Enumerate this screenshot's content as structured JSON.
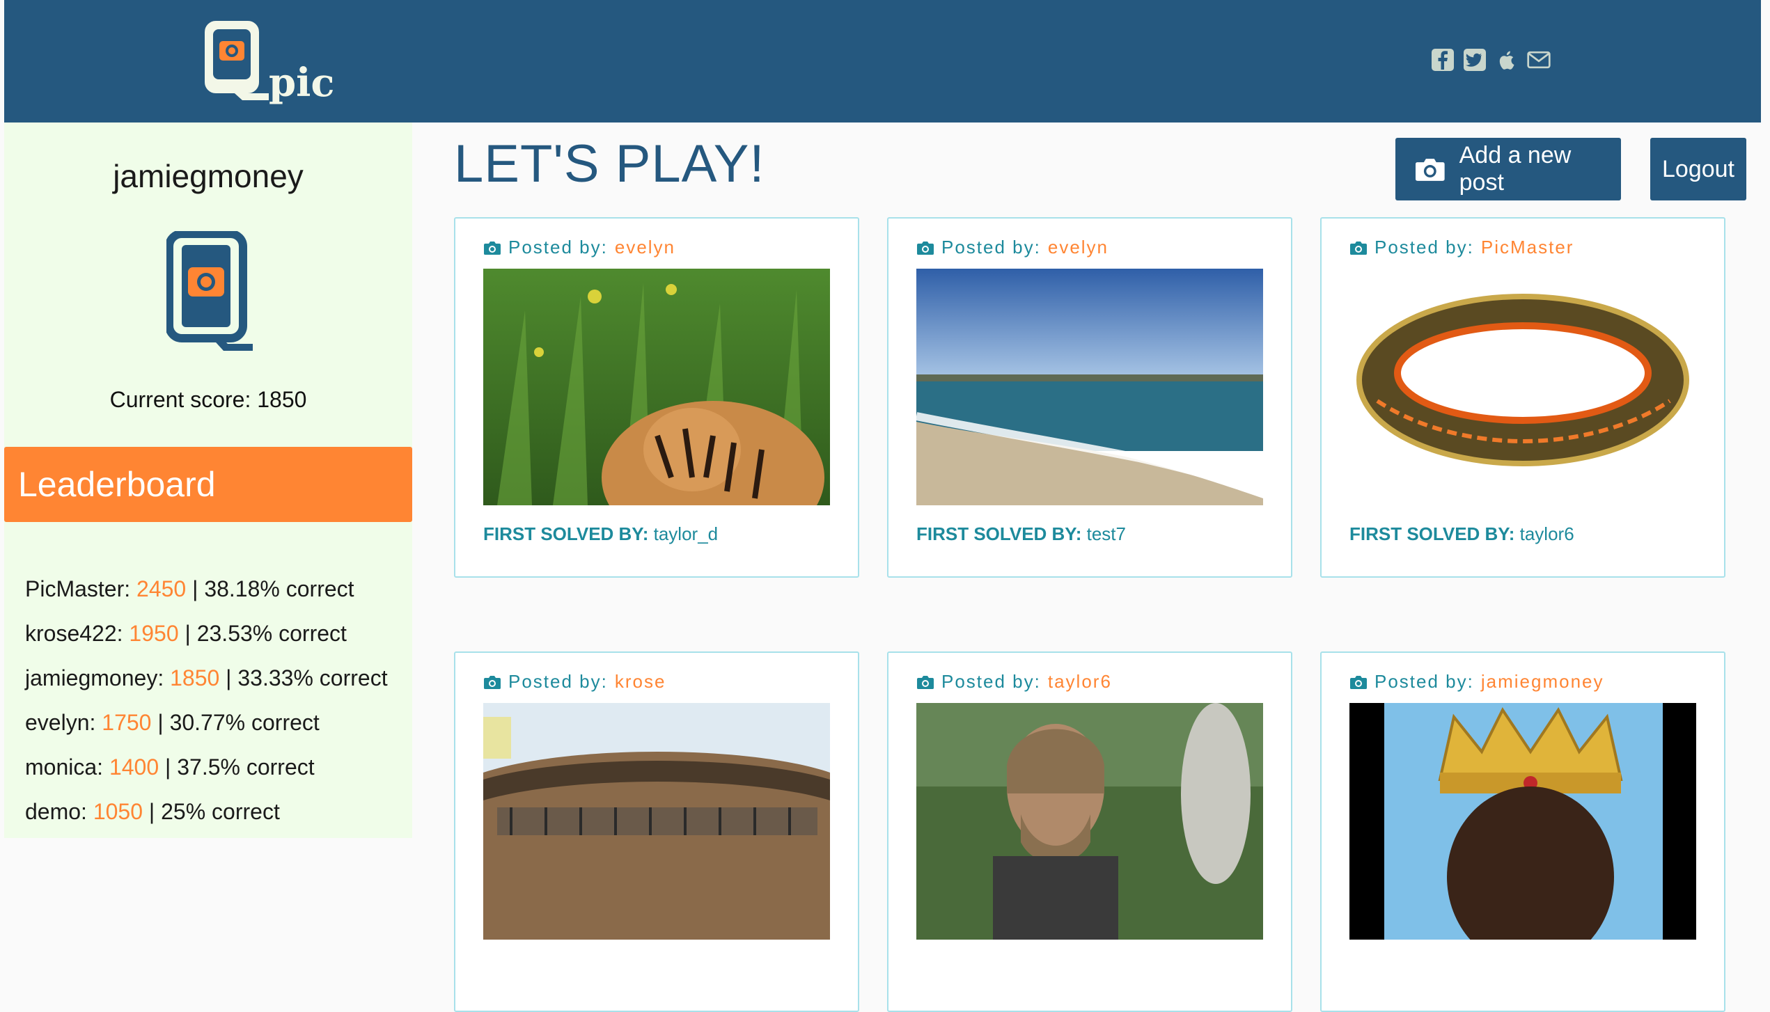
{
  "header": {
    "logo_text": "pic",
    "social_icons": [
      "facebook-icon",
      "twitter-icon",
      "apple-icon",
      "mail-icon"
    ]
  },
  "sidebar": {
    "username": "jamiegmoney",
    "score_label": "Current score:",
    "score_value": "1850",
    "leaderboard_title": "Leaderboard",
    "leaderboard": [
      {
        "name": "PicMaster:",
        "points": "2450",
        "pct": "| 38.18% correct"
      },
      {
        "name": "krose422:",
        "points": "1950",
        "pct": "| 23.53% correct"
      },
      {
        "name": "jamiegmoney:",
        "points": "1850",
        "pct": "| 33.33% correct"
      },
      {
        "name": "evelyn:",
        "points": "1750",
        "pct": "| 30.77% correct"
      },
      {
        "name": "monica:",
        "points": "1400",
        "pct": "| 37.5% correct"
      },
      {
        "name": "demo:",
        "points": "1050",
        "pct": "| 25% correct"
      }
    ]
  },
  "main": {
    "title": "LET'S PLAY!",
    "add_post_label": "Add a new post",
    "logout_label": "Logout",
    "posted_by_label": "Posted by:",
    "first_solved_label": "FIRST SOLVED BY:",
    "posts": [
      {
        "author": "evelyn",
        "solved_by": "taylor_d",
        "image": "tiger cub in grass"
      },
      {
        "author": "evelyn",
        "solved_by": "test7",
        "image": "beach shoreline"
      },
      {
        "author": "PicMaster",
        "solved_by": "taylor6",
        "image": "gold ring with inscription"
      },
      {
        "author": "krose",
        "image": "round glass building"
      },
      {
        "author": "taylor6",
        "image": "bearded man"
      },
      {
        "author": "jamiegmoney",
        "image": "man wearing crown"
      }
    ]
  },
  "colors": {
    "primary": "#25587f",
    "accent": "#ff8533",
    "teal": "#1d8a9c",
    "sidebar_bg": "#f0fde9",
    "card_border": "#a8e1ea"
  }
}
